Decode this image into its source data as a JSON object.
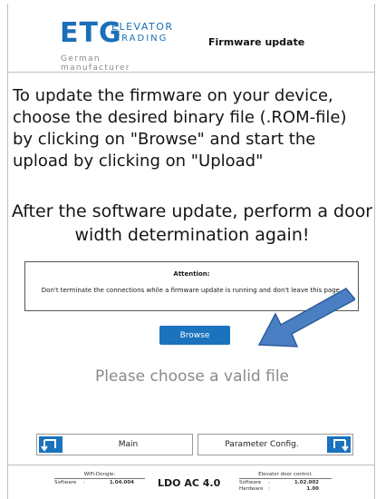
{
  "header": {
    "logo_main": "ETG",
    "logo_elevator": "ELEVATOR",
    "logo_trading": "TRADING",
    "logo_sub": "German manufacturer",
    "title": "Firmware update"
  },
  "instructions": {
    "intro": "To update the firmware on your device, choose the desired binary file (.ROM-file) by clicking on \"Browse\" and start the upload by clicking on \"Upload\"",
    "after_update": "After the software update, perform a door width determination again!"
  },
  "attention": {
    "title": "Attention:",
    "text": "Don't terminate the connections while a firmware update is running and don't leave this page."
  },
  "browse_label": "Browse",
  "status_text": "Please choose a valid file",
  "nav": {
    "main_label": "Main",
    "param_label": "Parameter Config."
  },
  "footer": {
    "wifi_title": "WiFi-Dongle:",
    "wifi_software_key": "Software",
    "wifi_sep": ":",
    "wifi_software_value": "1.04.004",
    "model": "LDO AC 4.0",
    "door_title": "Elevator door control:",
    "door_software_key": "Software",
    "door_sep": ":",
    "door_software_value": "1.02.002",
    "door_hardware_key": "Hardware",
    "door_hardware_sep": ":",
    "door_hardware_value": "1.00"
  },
  "colors": {
    "accent": "#1b72bd",
    "annotation_arrow": "#4a7fc4"
  },
  "icons": {
    "main_nav_icon": "return-left-icon",
    "param_nav_icon": "return-right-icon"
  }
}
